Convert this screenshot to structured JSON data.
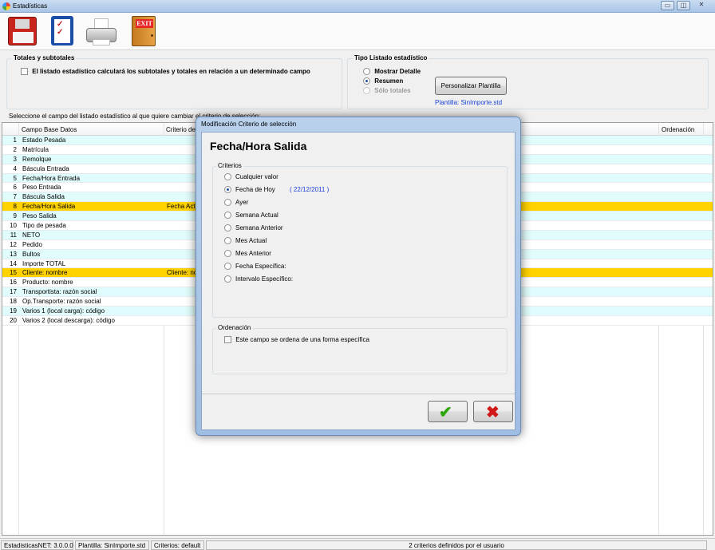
{
  "window": {
    "title": "Estadísticas",
    "controls": [
      "▭",
      "◫",
      "✕"
    ]
  },
  "toolbar": {
    "exit_label": "EXIT"
  },
  "totales": {
    "title": "Totales y subtotales",
    "checkbox_label": "El listado estadístico calculará los subtotales y totales en relación a un determinado campo"
  },
  "tipo": {
    "title": "Tipo Listado estadístico",
    "options": [
      {
        "label": "Mostrar Detalle",
        "selected": false
      },
      {
        "label": "Resumen",
        "selected": true
      },
      {
        "label": "Sólo totales",
        "selected": false,
        "disabled": true
      }
    ],
    "button": "Personalizar Plantilla",
    "plantilla": "Plantilla: SinImporte.std"
  },
  "grid": {
    "caption": "Seleccione el campo del listado estadístico al que quiere cambiar el criterio de selección:",
    "headers": {
      "campo": "Campo Base Datos",
      "criterio": "Criterio de",
      "ordenacion": "Ordenación"
    },
    "rows": [
      {
        "num": "1",
        "campo": "Estado Pesada",
        "criterio": ""
      },
      {
        "num": "2",
        "campo": "Matrícula",
        "criterio": ""
      },
      {
        "num": "3",
        "campo": "Remolque",
        "criterio": ""
      },
      {
        "num": "4",
        "campo": "Báscula Entrada",
        "criterio": ""
      },
      {
        "num": "5",
        "campo": "Fecha/Hora Entrada",
        "criterio": ""
      },
      {
        "num": "6",
        "campo": "Peso Entrada",
        "criterio": ""
      },
      {
        "num": "7",
        "campo": "Báscula Salida",
        "criterio": ""
      },
      {
        "num": "8",
        "campo": "Fecha/Hora Salida",
        "criterio": "Fecha Actu"
      },
      {
        "num": "9",
        "campo": "Peso Salida",
        "criterio": ""
      },
      {
        "num": "10",
        "campo": "Tipo de pesada",
        "criterio": ""
      },
      {
        "num": "11",
        "campo": "NETO",
        "criterio": ""
      },
      {
        "num": "12",
        "campo": "Pedido",
        "criterio": ""
      },
      {
        "num": "13",
        "campo": "Bultos",
        "criterio": ""
      },
      {
        "num": "14",
        "campo": "Importe TOTAL",
        "criterio": ""
      },
      {
        "num": "15",
        "campo": "Cliente: nombre",
        "criterio": "Cliente: no"
      },
      {
        "num": "16",
        "campo": "Producto: nombre",
        "criterio": ""
      },
      {
        "num": "17",
        "campo": "Transportista: razón social",
        "criterio": ""
      },
      {
        "num": "18",
        "campo": "Op.Transporte: razón social",
        "criterio": ""
      },
      {
        "num": "19",
        "campo": "Varios 1 (local carga): código",
        "criterio": ""
      },
      {
        "num": "20",
        "campo": "Varios 2 (local descarga): código",
        "criterio": ""
      }
    ],
    "selected_rows": [
      "8",
      "15"
    ]
  },
  "dialog": {
    "title": "Modificación Criterio de selección",
    "heading": "Fecha/Hora Salida",
    "criterios_title": "Criterios",
    "options": [
      {
        "label": "Cualquier valor",
        "selected": false
      },
      {
        "label": "Fecha de Hoy",
        "selected": true
      },
      {
        "label": "Ayer",
        "selected": false
      },
      {
        "label": "Semana Actual",
        "selected": false
      },
      {
        "label": "Semana Anterior",
        "selected": false
      },
      {
        "label": "Mes Actual",
        "selected": false
      },
      {
        "label": "Mes Anterior",
        "selected": false
      },
      {
        "label": "Fecha Específica:",
        "selected": false
      },
      {
        "label": "Intervalo Específico:",
        "selected": false
      }
    ],
    "today_value": "( 22/12/2011 )",
    "ordenacion_title": "Ordenación",
    "ordenacion_checkbox": "Este campo se ordena de una forma específica",
    "ok_glyph": "✔",
    "cancel_glyph": "✖"
  },
  "status": {
    "version": "EstadisticasNET: 3.0.0.0",
    "plantilla": "Plantilla: SinImporte.std",
    "criterios": "Criterios: default",
    "summary": "2 criterios definidos por el usuario"
  },
  "colors": {
    "selected_row": "#ffd200",
    "alt_row": "#e0fcfc",
    "link_blue": "#1a3fd6",
    "ok_green": "#2ea80b",
    "cancel_red": "#d11818"
  }
}
